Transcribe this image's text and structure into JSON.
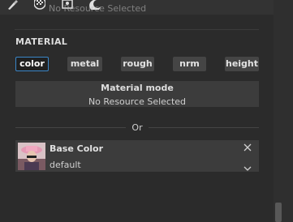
{
  "toolbar": {
    "icons": [
      "brush-icon",
      "checker-texture-icon",
      "image-frame-icon",
      "moon-icon"
    ],
    "caption": "No Resource Selected"
  },
  "material": {
    "section_title": "MATERIAL",
    "tabs": [
      {
        "label": "color",
        "active": true
      },
      {
        "label": "metal",
        "active": false
      },
      {
        "label": "rough",
        "active": false
      },
      {
        "label": "nrm",
        "active": false
      },
      {
        "label": "height",
        "active": false
      }
    ],
    "mode": {
      "title": "Material mode",
      "value": "No Resource Selected"
    },
    "or_label": "Or",
    "resource": {
      "name": "Base Color",
      "value": "default"
    }
  },
  "colors": {
    "accent": "#3a86c8",
    "panel": "#2b2b2b",
    "field": "#3c3c3c",
    "tab": "#454545"
  }
}
